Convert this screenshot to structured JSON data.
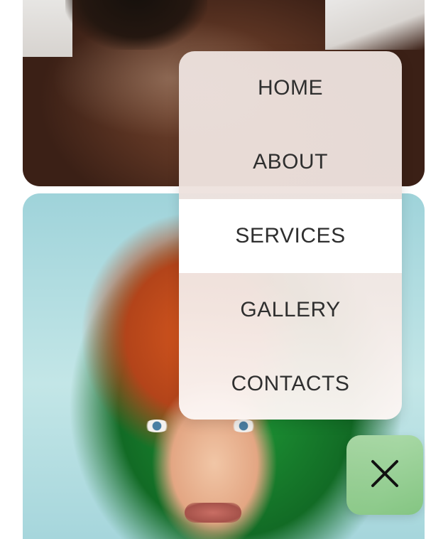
{
  "gallery": {
    "photos": [
      "shoulder-portrait",
      "red-hair-green-hood-portrait"
    ]
  },
  "menu": {
    "items": [
      {
        "label": "HOME"
      },
      {
        "label": "ABOUT"
      },
      {
        "label": "SERVICES"
      },
      {
        "label": "GALLERY"
      },
      {
        "label": "CONTACTS"
      }
    ],
    "active": "SERVICES"
  },
  "close_button": {
    "icon": "close-icon",
    "color": "#8fcc8a"
  },
  "colors": {
    "menu_text": "#2f2f2f",
    "menu_bg": "#ece1dd",
    "active_item_bg": "#ffffff"
  }
}
